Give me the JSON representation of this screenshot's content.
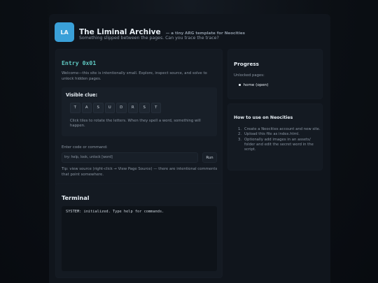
{
  "header": {
    "logo_text": "LA",
    "title": "The Liminal Archive",
    "subtitle": "— a tiny ARG template for Neocities",
    "tagline": "Something slipped between the pages. Can you trace the trace?"
  },
  "entry": {
    "title": "Entry 0x01",
    "description": "Welcome—this site is intentionally small. Explore, inspect source, and solve to unlock hidden pages.",
    "clue_label": "Visible clue:",
    "tiles": [
      "T",
      "A",
      "S",
      "U",
      "D",
      "R",
      "S",
      "T"
    ],
    "clue_hint": "Click tiles to rotate the letters. When they spell a word, something will happen.",
    "command_label": "Enter code or command:",
    "command_placeholder": "try: help, look, unlock [word]",
    "run_label": "Run",
    "tip": "Tip: view source (right-click → View Page Source) — there are intentional comments that point somewhere."
  },
  "progress": {
    "title": "Progress",
    "label": "Unlocked pages:",
    "items": [
      "home (open)"
    ]
  },
  "howto": {
    "title": "How to use on Neocities",
    "steps": [
      {
        "num": "1.",
        "text": "Create a Neocities account and new site."
      },
      {
        "num": "2.",
        "text": "Upload this file as index.html."
      },
      {
        "num": "3.",
        "text": "Optionally add images in an assets/ folder and edit the secret word in the script."
      }
    ]
  },
  "terminal": {
    "title": "Terminal",
    "output": "SYSTEM: initialized. Type help for commands."
  },
  "colors": {
    "accent": "#5fc9c2",
    "logo_bg": "#3aa0d8",
    "panel": "#141a22",
    "background": "#0b0f14"
  },
  "icons": {
    "progress_bullet": "disc-bullet-icon"
  }
}
